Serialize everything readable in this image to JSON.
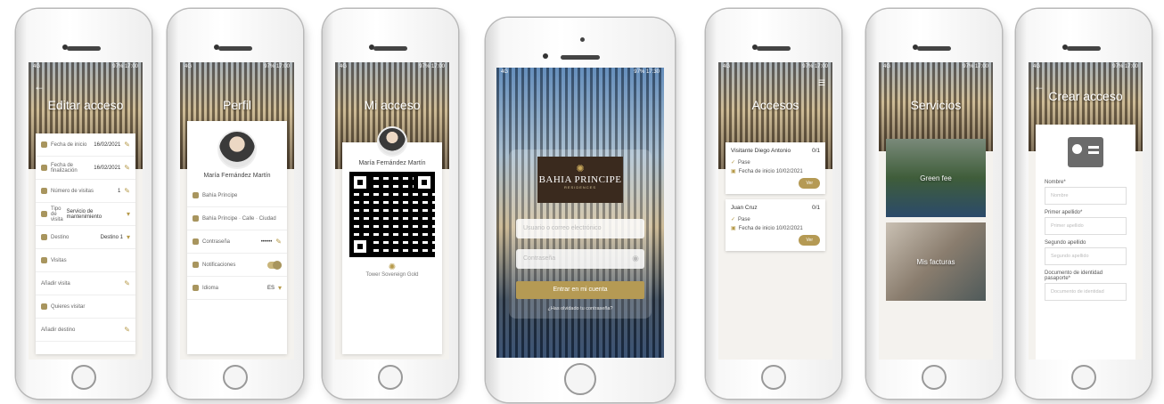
{
  "phones": {
    "edit": {
      "title": "Editar acceso",
      "rows": [
        {
          "label": "Fecha de inicio",
          "value": "16/02/2021"
        },
        {
          "label": "Fecha de finalización",
          "value": "16/02/2021"
        },
        {
          "label": "Número de visitas",
          "value": "1"
        },
        {
          "label": "Tipo de visita",
          "value": "Servicio de mantenimiento"
        },
        {
          "label": "Destino",
          "value": "Destino 1"
        },
        {
          "label": "Visitas",
          "value": ""
        },
        {
          "label": "Añadir visita",
          "value": ""
        },
        {
          "label": "Quieres visitar",
          "value": ""
        },
        {
          "label": "Añadir destino",
          "value": ""
        }
      ]
    },
    "profile": {
      "title": "Perfil",
      "name": "María Fernández Martín",
      "rows": [
        {
          "label": "Bahía Príncipe",
          "value": ""
        },
        {
          "label": "Bahía Príncipe · Calle · Ciudad",
          "value": ""
        },
        {
          "label": "Contraseña",
          "value": "••••••"
        },
        {
          "label": "Notificaciones",
          "value": ""
        },
        {
          "label": "Idioma",
          "value": "ES"
        }
      ]
    },
    "myaccess": {
      "title": "Mi acceso",
      "name": "María Fernández Martín",
      "logo": "Tower Sovereign Gold"
    },
    "login": {
      "brand_name": "BAHIA PRINCIPE",
      "brand_sub": "RESIDENCES",
      "username_placeholder": "Usuario o correo electrónico",
      "password_placeholder": "Contraseña",
      "submit_label": "Entrar en mi cuenta",
      "forgot_label": "¿Has olvidado tu contraseña?"
    },
    "accesses": {
      "title": "Accesos",
      "cards": [
        {
          "name": "Visitante Diego Antonio",
          "count": "0/1",
          "line1": "Pase",
          "line2": "Fecha de inicio 10/02/2021",
          "action": "Ver"
        },
        {
          "name": "Juan Cruz",
          "count": "0/1",
          "line1": "Pase",
          "line2": "Fecha de inicio 10/02/2021",
          "action": "Ver"
        }
      ]
    },
    "services": {
      "title": "Servicios",
      "tiles": [
        "Green fee",
        "Mis facturas"
      ]
    },
    "create": {
      "title": "Crear acceso",
      "fields": [
        {
          "label": "Nombre*",
          "placeholder": "Nombre"
        },
        {
          "label": "Primer apellido*",
          "placeholder": "Primer apellido"
        },
        {
          "label": "Segundo apellido",
          "placeholder": "Segundo apellido"
        },
        {
          "label": "Documento de identidad pasaporte*",
          "placeholder": "Documento de identidad"
        }
      ]
    }
  }
}
